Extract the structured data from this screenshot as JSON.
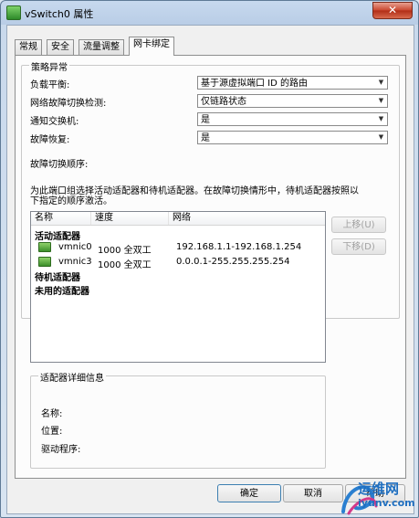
{
  "window": {
    "title": "vSwitch0 属性",
    "close_glyph": "✕"
  },
  "tabs": [
    "常规",
    "安全",
    "流量调整",
    "网卡绑定"
  ],
  "policy": {
    "group_title": "策略异常",
    "fields": [
      {
        "label": "负载平衡:",
        "value": "基于源虚拟端口 ID 的路由"
      },
      {
        "label": "网络故障切换检测:",
        "value": "仅链路状态"
      },
      {
        "label": "通知交换机:",
        "value": "是"
      },
      {
        "label": "故障恢复:",
        "value": "是"
      }
    ],
    "failover_order_label": "故障切换顺序:",
    "description_line1": "为此端口组选择活动适配器和待机适配器。在故障切换情形中，待机适配器按照以",
    "description_line2": "下指定的顺序激活。"
  },
  "adapters": {
    "columns": [
      "名称",
      "速度",
      "网络"
    ],
    "active_label": "活动适配器",
    "active": [
      {
        "name": "vmnic0",
        "speed": "1000 全双工",
        "network": "192.168.1.1-192.168.1.254"
      },
      {
        "name": "vmnic3",
        "speed": "1000 全双工",
        "network": "0.0.0.1-255.255.255.254"
      }
    ],
    "standby_label": "待机适配器",
    "unused_label": "未用的适配器",
    "move_up": "上移(U)",
    "move_down": "下移(D)"
  },
  "details": {
    "group_title": "适配器详细信息",
    "name_label": "名称:",
    "location_label": "位置:",
    "driver_label": "驱动程序:"
  },
  "buttons": {
    "ok": "确定",
    "cancel": "取消",
    "help": "帮助"
  },
  "watermark": {
    "line1": "运维网",
    "line2": "iyunv.com"
  }
}
